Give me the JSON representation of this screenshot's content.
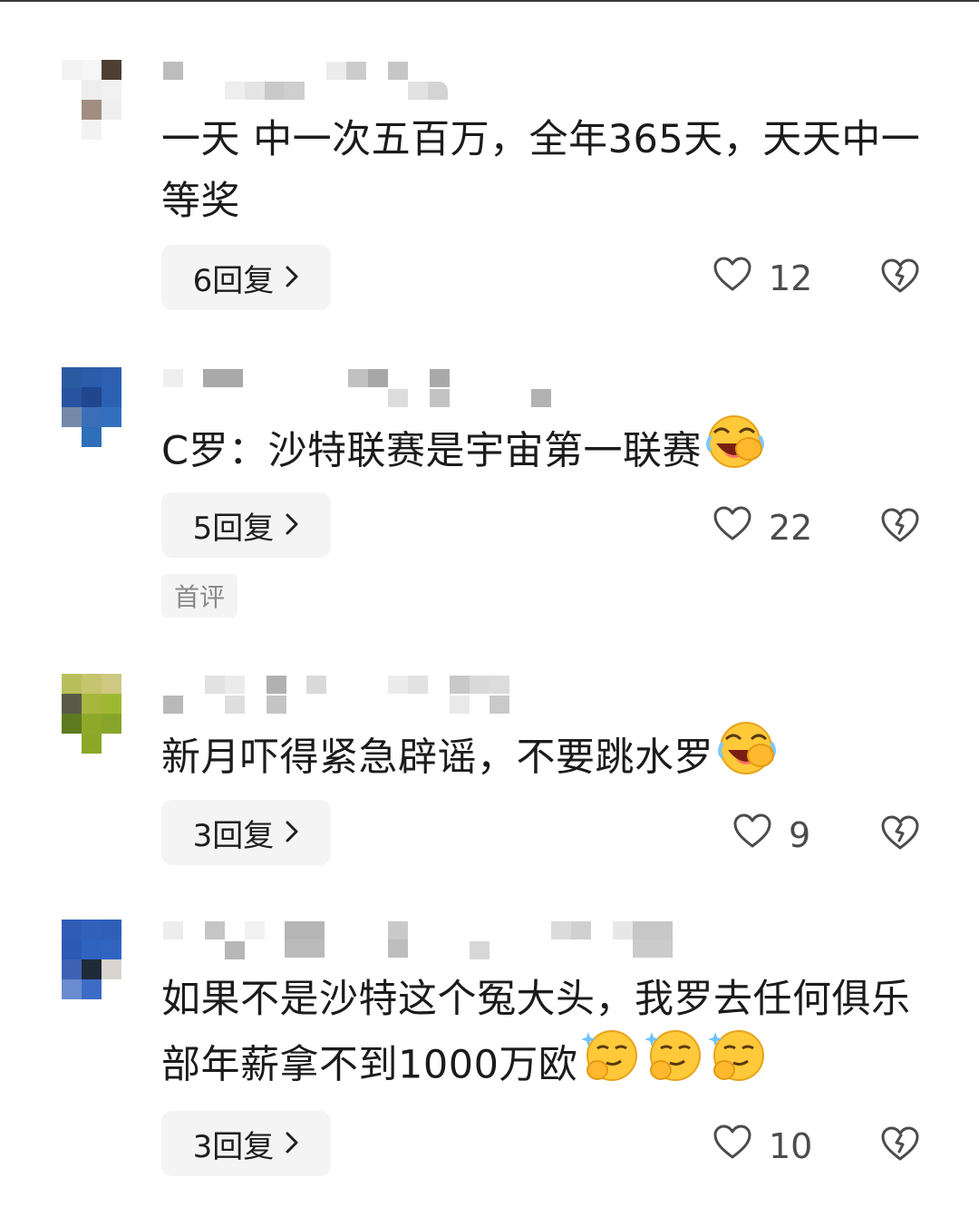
{
  "comments": [
    {
      "text": "一天 中一次五百万，全年365天，天天中一等奖",
      "replies": "6回复",
      "likes": "12",
      "emoji": []
    },
    {
      "text": "C罗：沙特联赛是宇宙第一联赛",
      "replies": "5回复",
      "likes": "22",
      "emoji": [
        "laugh-cry"
      ],
      "badge": "首评"
    },
    {
      "text": "新月吓得紧急辟谣，不要跳水罗",
      "replies": "3回复",
      "likes": "9",
      "emoji": [
        "laugh-cry"
      ]
    },
    {
      "text": "如果不是沙特这个冤大头，我罗去任何俱乐部年薪拿不到1000万欧",
      "replies": "3回复",
      "likes": "10",
      "emoji": [
        "smug-thinking",
        "smug-thinking",
        "smug-thinking"
      ]
    }
  ],
  "colors": {
    "reply_bg": "#f4f4f4",
    "icon": "#4c4c4c",
    "text": "#1b1b1b"
  },
  "icons": [
    "heart-outline-icon",
    "broken-heart-icon",
    "chevron-right-icon"
  ]
}
